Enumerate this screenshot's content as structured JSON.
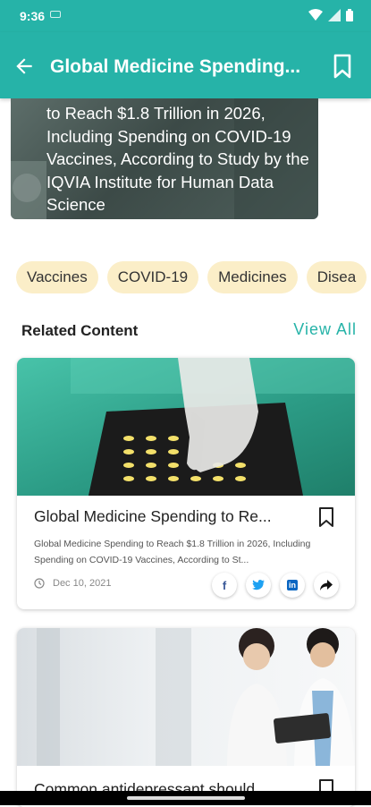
{
  "status": {
    "time": "9:36"
  },
  "app_bar": {
    "title": "Global Medicine Spending..."
  },
  "hero": {
    "text": "to Reach $1.8 Trillion in 2026, Including Spending on COVID-19 Vaccines, According to Study by the IQVIA Institute for Human Data Science"
  },
  "tags": [
    "Vaccines",
    "COVID-19",
    "Medicines",
    "Disea"
  ],
  "related": {
    "heading": "Related Content",
    "view_all": "View All"
  },
  "cards": [
    {
      "title": "Global Medicine Spending to Re...",
      "description": "Global Medicine Spending to Reach $1.8 Trillion in 2026, Including Spending on COVID-19 Vaccines, According to St...",
      "date": "Dec 10, 2021"
    },
    {
      "title": "Common antidepressant should..."
    }
  ],
  "share": {
    "facebook": "f",
    "twitter": "t",
    "linkedin": "in"
  },
  "icons": [
    "back-arrow-icon",
    "bookmark-icon",
    "clock-icon",
    "facebook-icon",
    "twitter-icon",
    "linkedin-icon",
    "share-icon"
  ],
  "colors": {
    "accent": "#26b3a8",
    "chip_bg": "#fbeec8",
    "facebook": "#3b5998",
    "twitter": "#1da1f2",
    "linkedin": "#0a66c2"
  }
}
